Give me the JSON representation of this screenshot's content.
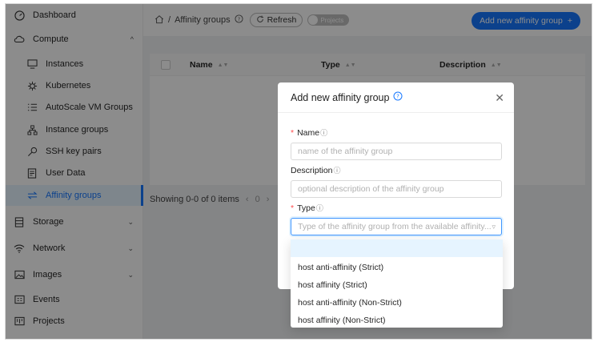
{
  "sidebar": {
    "items": [
      {
        "label": "Dashboard",
        "icon": "dashboard-icon"
      },
      {
        "label": "Compute",
        "icon": "cloud-icon",
        "chevron": "^"
      },
      {
        "label": "Instances",
        "icon": "desktop-icon"
      },
      {
        "label": "Kubernetes",
        "icon": "helm-icon"
      },
      {
        "label": "AutoScale VM Groups",
        "icon": "list-icon"
      },
      {
        "label": "Instance groups",
        "icon": "cluster-icon"
      },
      {
        "label": "SSH key pairs",
        "icon": "key-icon"
      },
      {
        "label": "User Data",
        "icon": "document-icon"
      },
      {
        "label": "Affinity groups",
        "icon": "swap-icon"
      },
      {
        "label": "Storage",
        "icon": "storage-icon",
        "chevron": "⌄"
      },
      {
        "label": "Network",
        "icon": "wifi-icon",
        "chevron": "⌄"
      },
      {
        "label": "Images",
        "icon": "image-icon",
        "chevron": "⌄"
      },
      {
        "label": "Events",
        "icon": "events-icon"
      },
      {
        "label": "Projects",
        "icon": "project-icon"
      }
    ]
  },
  "header": {
    "breadcrumb_sep": "/",
    "breadcrumb_current": "Affinity groups",
    "refresh_label": "Refresh",
    "projects_toggle_label": "Projects",
    "add_button_label": "Add new affinity group",
    "add_button_icon": "+"
  },
  "table": {
    "columns": [
      "Name",
      "Type",
      "Description"
    ],
    "pagination_text": "Showing 0-0 of 0 items",
    "page_number": "0"
  },
  "modal": {
    "title": "Add new affinity group",
    "name_label": "Name",
    "name_placeholder": "name of the affinity group",
    "description_label": "Description",
    "description_placeholder": "optional description of the affinity group",
    "type_label": "Type",
    "type_placeholder": "Type of the affinity group from the available affinity...",
    "required_mark": "*"
  },
  "type_options": [
    "",
    "host anti-affinity (Strict)",
    "host affinity (Strict)",
    "host anti-affinity (Non-Strict)",
    "host affinity (Non-Strict)"
  ],
  "colors": {
    "accent": "#1677ff",
    "required": "#ff4d4f"
  }
}
